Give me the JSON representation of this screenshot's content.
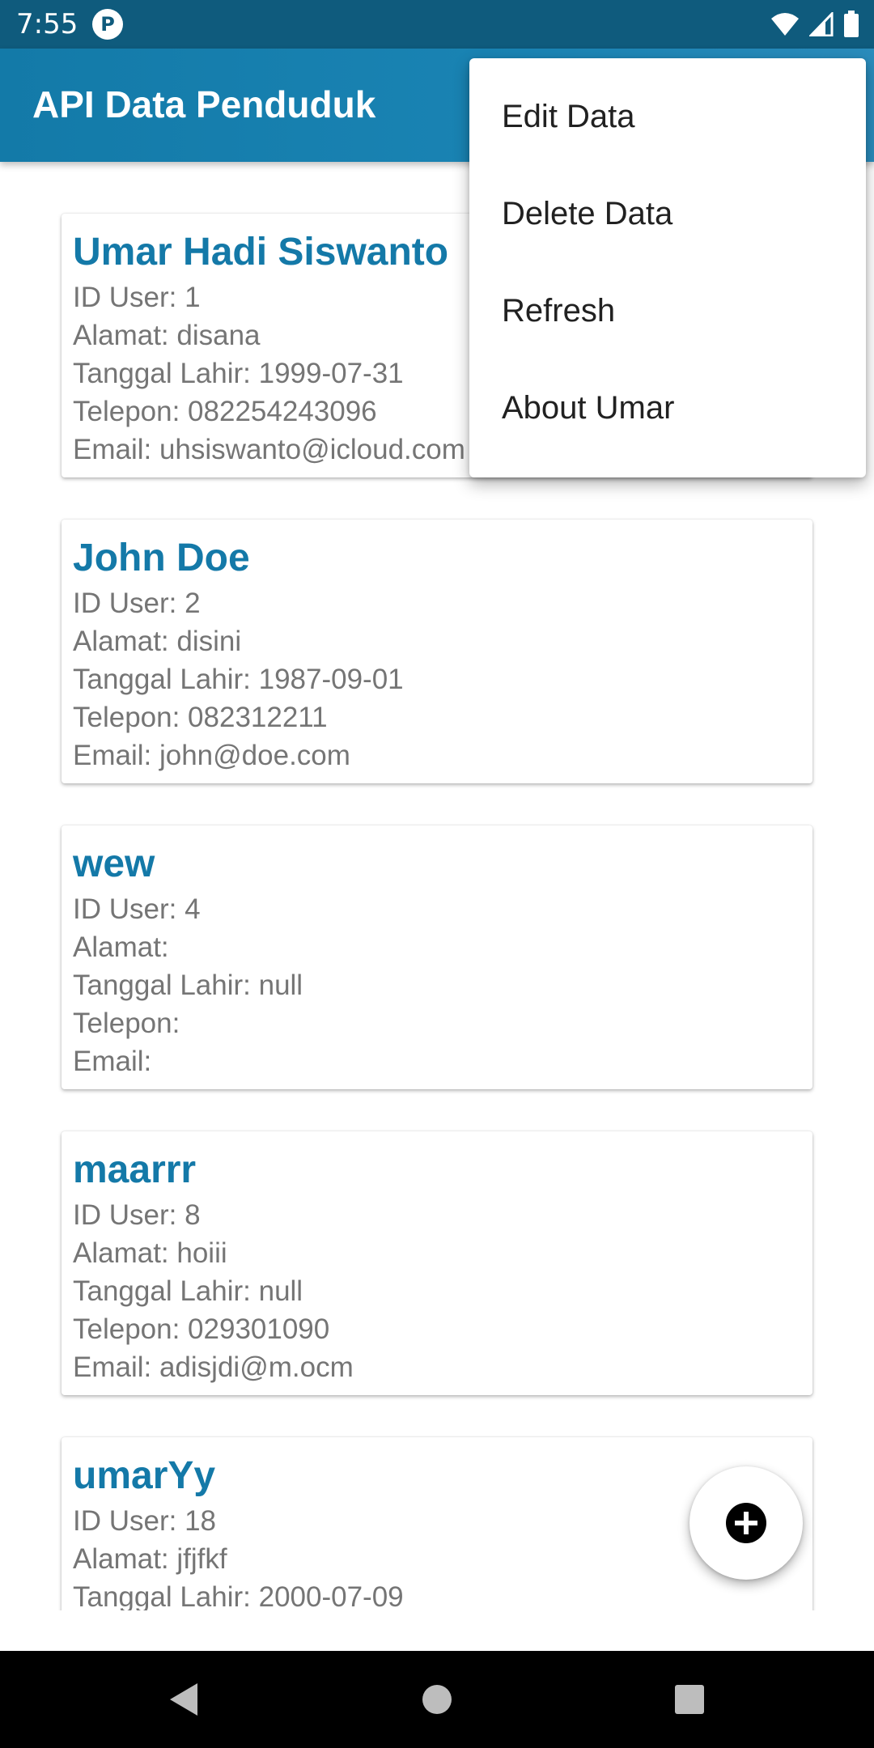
{
  "status_bar": {
    "time": "7:55",
    "app_icon_glyph": "P",
    "icons": [
      "wifi-icon",
      "cell-signal-icon",
      "battery-icon"
    ]
  },
  "app_bar": {
    "title": "API Data Penduduk"
  },
  "colors": {
    "app_bar": "#137aa8",
    "status_bar": "#0f5b7d",
    "name_text": "#1479a8",
    "detail_text": "#757575"
  },
  "records": [
    {
      "name": "Umar Hadi Siswanto",
      "id_line": "ID User: 1",
      "address_line": "Alamat: disana",
      "birth_line": "Tanggal Lahir: 1999-07-31",
      "phone_line": "Telepon: 082254243096",
      "email_line": "Email: uhsiswanto@icloud.com"
    },
    {
      "name": "John Doe",
      "id_line": "ID User: 2",
      "address_line": "Alamat: disini",
      "birth_line": "Tanggal Lahir: 1987-09-01",
      "phone_line": "Telepon: 082312211",
      "email_line": "Email: john@doe.com"
    },
    {
      "name": "wew",
      "id_line": "ID User: 4",
      "address_line": "Alamat:",
      "birth_line": "Tanggal Lahir: null",
      "phone_line": "Telepon:",
      "email_line": "Email:"
    },
    {
      "name": "maarrr",
      "id_line": "ID User: 8",
      "address_line": "Alamat: hoiii",
      "birth_line": "Tanggal Lahir: null",
      "phone_line": "Telepon: 029301090",
      "email_line": "Email: adisjdi@m.ocm"
    },
    {
      "name": "umarYy",
      "id_line": "ID User: 18",
      "address_line": "Alamat: jfjfkf",
      "birth_line": "Tanggal Lahir: 2000-07-09",
      "phone_line": "",
      "email_line": ""
    }
  ],
  "fab": {
    "icon": "add-circle-icon"
  },
  "overflow_menu": {
    "items": [
      {
        "label": "Edit Data"
      },
      {
        "label": "Delete Data"
      },
      {
        "label": "Refresh"
      },
      {
        "label": "About Umar"
      }
    ]
  },
  "nav_bar": {
    "buttons": [
      "back-icon",
      "home-icon",
      "recents-icon"
    ]
  }
}
